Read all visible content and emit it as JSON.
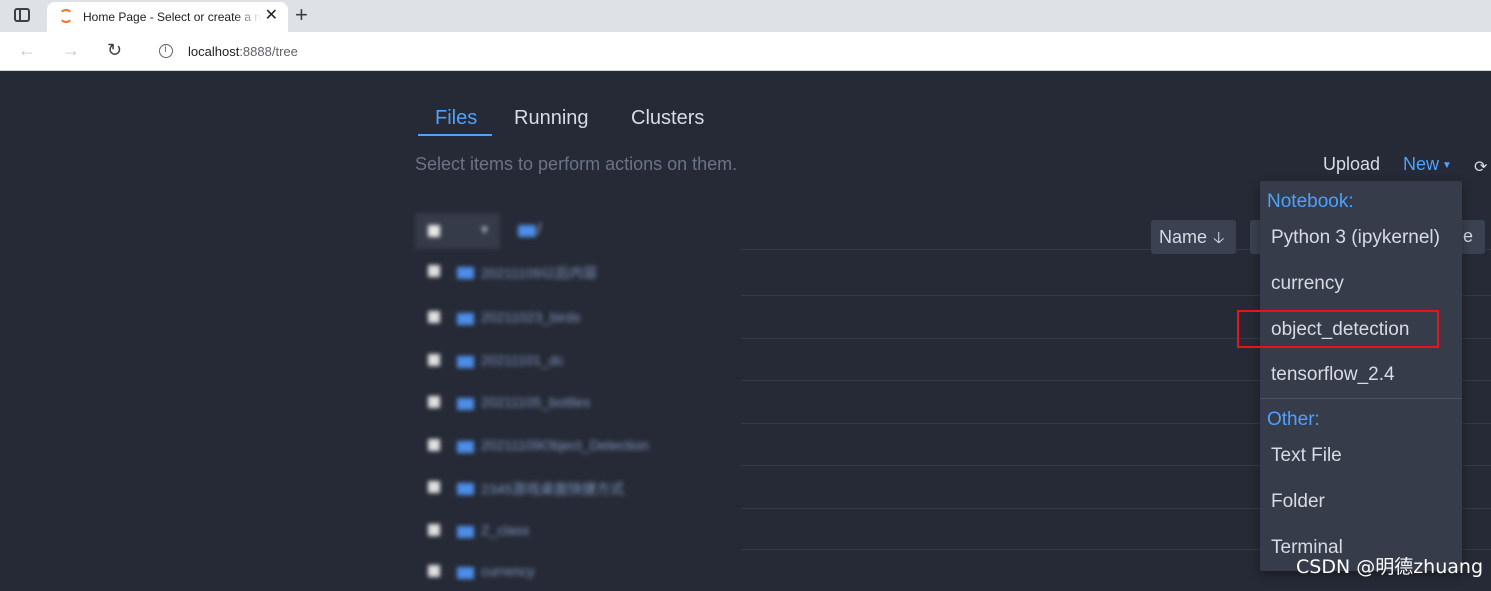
{
  "browser": {
    "tab_title": "Home Page - Select or create a notebook",
    "url_host": "localhost",
    "url_path": ":8888/tree"
  },
  "jupyter": {
    "tabs": [
      "Files",
      "Running",
      "Clusters"
    ],
    "hint": "Select items to perform actions on them.",
    "upload_label": "Upload",
    "new_label": "New",
    "name_sort_label": "Name",
    "hidden_btn_tail": "e",
    "new_menu": {
      "notebook_header": "Notebook:",
      "notebook_items": [
        "Python 3 (ipykernel)",
        "currency",
        "object_detection",
        "tensorflow_2.4"
      ],
      "other_header": "Other:",
      "other_items": [
        "Text File",
        "Folder",
        "Terminal"
      ]
    },
    "blurred_rows": [
      "20211109以后内容",
      "20211023_birds",
      "20211101_dc",
      "20211105_bottles",
      "20211109Object_Detection",
      "2345游戏桌面快捷方式",
      "Z_class",
      "currency"
    ]
  },
  "watermark": "CSDN @明德zhuang",
  "colors": {
    "page_bg": "#262a36",
    "accent": "#4ea1ff",
    "highlight": "#e8141c"
  }
}
